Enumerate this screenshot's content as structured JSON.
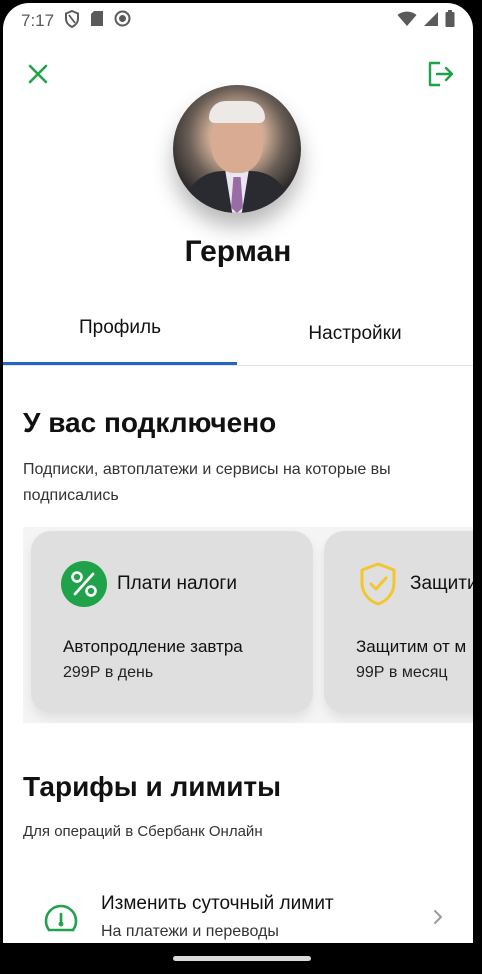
{
  "status_bar": {
    "time": "7:17",
    "icons_left": [
      "shield-icon",
      "sd-card-icon",
      "record-icon"
    ],
    "icons_right": [
      "wifi-icon",
      "signal-icon",
      "battery-icon"
    ]
  },
  "top_bar": {
    "close_icon": "close-icon",
    "logout_icon": "logout-icon"
  },
  "profile": {
    "name": "Герман"
  },
  "tabs": [
    {
      "label": "Профиль",
      "active": true
    },
    {
      "label": "Настройки",
      "active": false
    }
  ],
  "subscriptions": {
    "title": "У вас подключено",
    "description": "Подписки, автоплатежи и сервисы на которые вы подписались",
    "cards": [
      {
        "icon": "percent-icon",
        "title": "Плати налоги",
        "line1": "Автопродление завтра",
        "line2": "299Р в день"
      },
      {
        "icon": "shield-check-icon",
        "title": "Защитим",
        "line1": "Защитим от м",
        "line2": "99Р в месяц"
      }
    ]
  },
  "tariffs": {
    "title": "Тарифы и лимиты",
    "description": "Для операций в Сбербанк Онлайн",
    "items": [
      {
        "icon": "speedometer-icon",
        "title": "Изменить суточный лимит",
        "subtitle": "На платежи и переводы"
      }
    ]
  },
  "colors": {
    "accent_green": "#1fa24a",
    "tab_indicator_blue": "#2167c7",
    "shield_yellow": "#f2c62f",
    "card_bg": "#dedfde"
  }
}
